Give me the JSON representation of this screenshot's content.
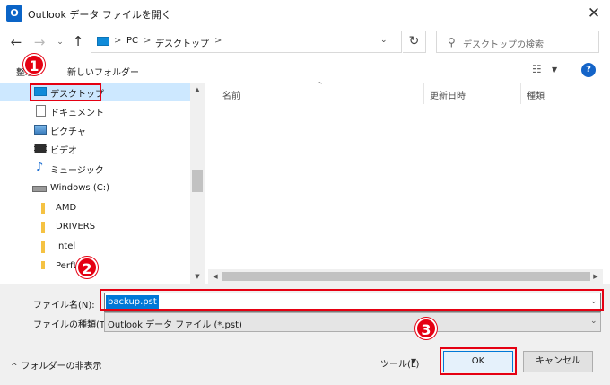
{
  "window": {
    "title": "Outlook データ ファイルを開く",
    "app_icon": "outlook-icon",
    "close_glyph": "✕"
  },
  "address": {
    "back_glyph": "←",
    "forward_glyph": "→",
    "recent_glyph": "⌄",
    "up_glyph": "↑",
    "crumbs": [
      "PC",
      "デスクトップ"
    ],
    "separator": ">",
    "dropdown_glyph": "⌄",
    "refresh_glyph": "↻",
    "search_placeholder": "デスクトップの検索",
    "search_icon": "search-icon"
  },
  "toolbar": {
    "organize_label": "整理",
    "new_folder_label": "新しいフォルダー",
    "view_glyph": "☷",
    "help_label": "?"
  },
  "nav": {
    "items": [
      {
        "label": "デスクトップ",
        "icon": "desktop-icon",
        "selected": true,
        "indent": 1
      },
      {
        "label": "ドキュメント",
        "icon": "documents-icon",
        "indent": 1
      },
      {
        "label": "ピクチャ",
        "icon": "pictures-icon",
        "indent": 1
      },
      {
        "label": "ビデオ",
        "icon": "videos-icon",
        "indent": 1
      },
      {
        "label": "ミュージック",
        "icon": "music-icon",
        "indent": 1
      },
      {
        "label": "Windows (C:)",
        "icon": "drive-icon",
        "indent": 1
      },
      {
        "label": "AMD",
        "icon": "folder-icon",
        "indent": 2
      },
      {
        "label": "DRIVERS",
        "icon": "folder-icon",
        "indent": 2
      },
      {
        "label": "Intel",
        "icon": "folder-icon",
        "indent": 2
      },
      {
        "label": "PerfLogs",
        "icon": "folder-icon",
        "indent": 2
      }
    ]
  },
  "file_list": {
    "columns": [
      "名前",
      "更新日時",
      "種類"
    ]
  },
  "bottom": {
    "filename_label": "ファイル名(N):",
    "filename_value": "backup.pst",
    "filetype_label": "ファイルの種類(T):",
    "filetype_value": "Outlook データ ファイル (*.pst)",
    "hide_folders_label": "フォルダーの非表示",
    "tools_label": "ツール(L)",
    "ok_label": "OK",
    "cancel_label": "キャンセル"
  },
  "annotations": {
    "step1": "1",
    "step2": "2",
    "step3": "3"
  },
  "colors": {
    "annotation_red": "#e50012",
    "selection_blue": "#0078d7",
    "nav_selected": "#cde8ff",
    "folder_yellow": "#f5c242"
  }
}
